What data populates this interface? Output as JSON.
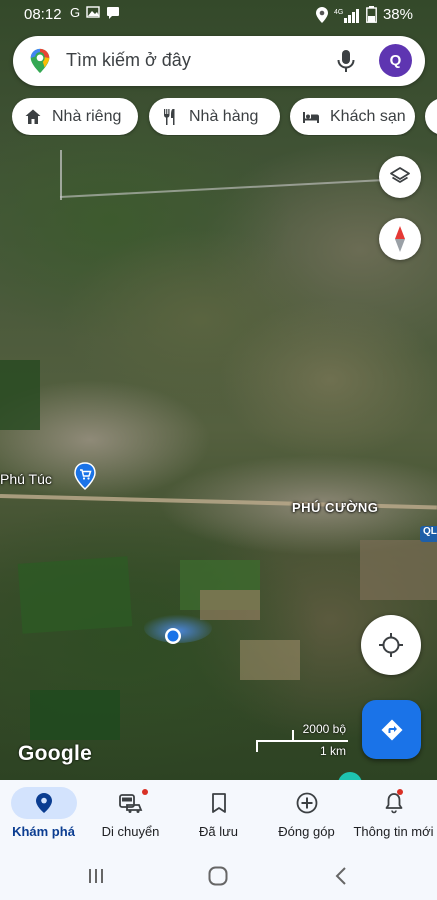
{
  "status_bar": {
    "time": "08:12",
    "left_icons": [
      "G",
      "gallery-icon",
      "message-icon"
    ],
    "right_icons": [
      "location-icon",
      "4g-signal-icon"
    ],
    "battery": "38%"
  },
  "search": {
    "placeholder": "Tìm kiếm ở đây",
    "avatar_letter": "Q"
  },
  "chips": [
    {
      "label": "Nhà riêng",
      "icon": "home-icon"
    },
    {
      "label": "Nhà hàng",
      "icon": "restaurant-icon"
    },
    {
      "label": "Khách sạn",
      "icon": "hotel-icon"
    },
    {
      "label": "",
      "icon": "more-chip"
    }
  ],
  "map": {
    "labels": {
      "phu_tuc": "Phú Túc",
      "phu_cuong": "PHÚ CƯỜNG",
      "ql_badge": "QL"
    },
    "attribution": "Google",
    "scale": {
      "top": "2000 bộ",
      "bottom": "1 km"
    }
  },
  "bottom_nav": [
    {
      "label": "Khám phá",
      "icon": "explore-pin-icon",
      "active": true
    },
    {
      "label": "Di chuyển",
      "icon": "commute-icon",
      "badge": true
    },
    {
      "label": "Đã lưu",
      "icon": "bookmark-icon"
    },
    {
      "label": "Đóng góp",
      "icon": "add-circle-icon"
    },
    {
      "label": "Thông tin mới",
      "icon": "bell-icon",
      "badge": true
    }
  ],
  "colors": {
    "accent": "#1a73e8",
    "avatar": "#5e35b1",
    "nav_active_bg": "#d3e3fd",
    "badge": "#d93025"
  }
}
